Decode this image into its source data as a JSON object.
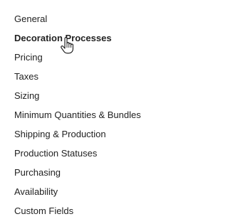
{
  "settings_nav": {
    "items": [
      {
        "label": "General",
        "active": false
      },
      {
        "label": "Decoration Processes",
        "active": true
      },
      {
        "label": "Pricing",
        "active": false
      },
      {
        "label": "Taxes",
        "active": false
      },
      {
        "label": "Sizing",
        "active": false
      },
      {
        "label": "Minimum Quantities & Bundles",
        "active": false
      },
      {
        "label": "Shipping & Production",
        "active": false
      },
      {
        "label": "Production Statuses",
        "active": false
      },
      {
        "label": "Purchasing",
        "active": false
      },
      {
        "label": "Availability",
        "active": false
      },
      {
        "label": "Custom Fields",
        "active": false
      }
    ]
  },
  "cursor": {
    "icon": "hand-pointer-icon"
  }
}
